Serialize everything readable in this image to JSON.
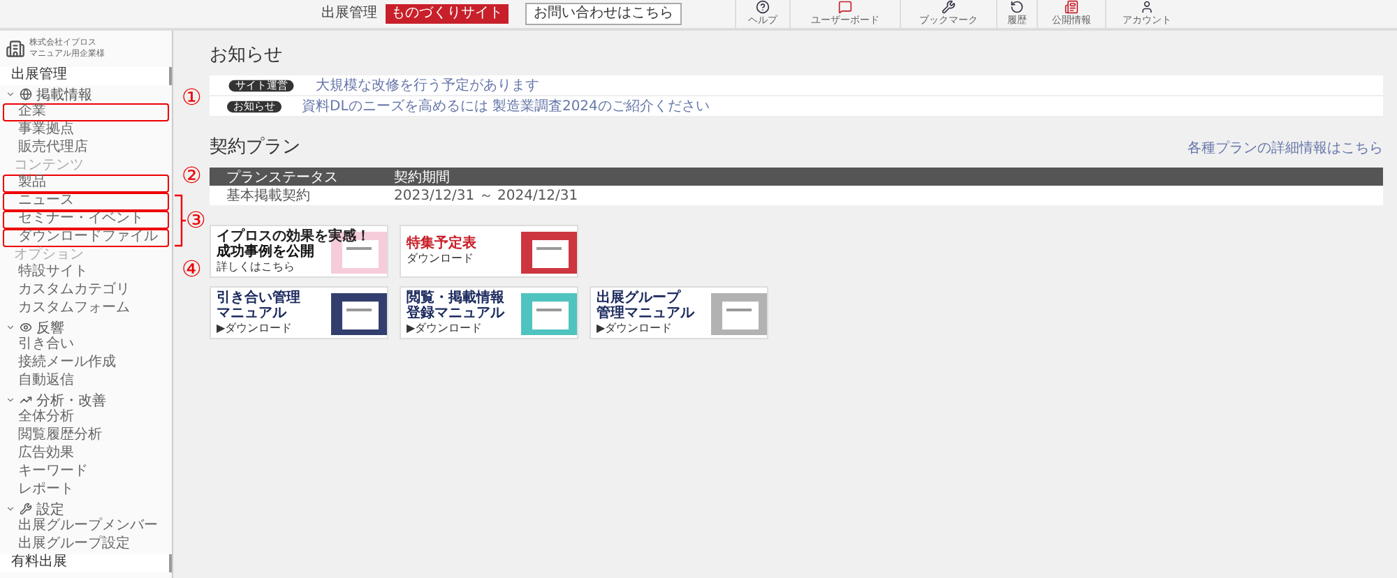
{
  "top_bar": {
    "title": "出展管理",
    "badge": "ものづくりサイト",
    "contact_button": "お問い合わせはこちら",
    "tools": [
      {
        "label": "ヘルプ"
      },
      {
        "label": "ユーザーボード"
      },
      {
        "label": "ブックマーク"
      },
      {
        "label": "履歴"
      },
      {
        "label": "公開情報"
      },
      {
        "label": "アカウント"
      }
    ]
  },
  "sidebar": {
    "company": [
      "株式会社イプロス",
      "マニュアル用企業様"
    ],
    "entries": [
      {
        "kind": "title",
        "label": "出展管理"
      },
      {
        "kind": "group",
        "label": "掲載情報",
        "expanded": true,
        "children": [
          {
            "label": "企業",
            "highlighted": true
          },
          {
            "label": "事業拠点",
            "highlighted": false
          },
          {
            "label": "販売代理店",
            "highlighted": false
          }
        ]
      },
      {
        "kind": "heading",
        "label": "コンテンツ",
        "children": [
          {
            "label": "製品",
            "highlighted": true
          },
          {
            "label": "ニュース",
            "highlighted": true
          },
          {
            "label": "セミナー・イベント",
            "highlighted": true
          },
          {
            "label": "ダウンロードファイル",
            "highlighted": true
          }
        ]
      },
      {
        "kind": "heading",
        "label": "オプション",
        "children": [
          {
            "label": "特設サイト",
            "highlighted": false
          },
          {
            "label": "カスタムカテゴリ",
            "highlighted": false
          },
          {
            "label": "カスタムフォーム",
            "highlighted": false
          }
        ]
      },
      {
        "kind": "group",
        "label": "反響",
        "expanded": true,
        "children": [
          {
            "label": "引き合い",
            "highlighted": false
          },
          {
            "label": "接続メール作成",
            "highlighted": false
          },
          {
            "label": "自動返信",
            "highlighted": false
          }
        ]
      },
      {
        "kind": "group",
        "label": "分析・改善",
        "expanded": true,
        "children": [
          {
            "label": "全体分析",
            "highlighted": false
          },
          {
            "label": "閲覧履歴分析",
            "highlighted": false
          },
          {
            "label": "広告効果",
            "highlighted": false
          },
          {
            "label": "キーワード",
            "highlighted": false
          },
          {
            "label": "レポート",
            "highlighted": false
          }
        ]
      },
      {
        "kind": "group",
        "label": "設定",
        "expanded": true,
        "children": [
          {
            "label": "出展グループメンバー",
            "highlighted": false
          },
          {
            "label": "出展グループ設定",
            "highlighted": false
          }
        ]
      },
      {
        "kind": "title",
        "label": "有料出展"
      }
    ]
  },
  "notices": {
    "title": "お知らせ",
    "items": [
      {
        "tag": "サイト運営",
        "text": "大規模な改修を行う予定があります"
      },
      {
        "tag": "お知らせ",
        "text": "資料DLのニーズを高めるには 製造業調査2024のご紹介ください"
      }
    ]
  },
  "plan": {
    "title": "契約プラン",
    "link": "各種プランの詳細情報はこちら",
    "columns": [
      "プランステータス",
      "契約期間"
    ],
    "rows": [
      [
        "基本掲載契約",
        "2023/12/31 ～ 2024/12/31"
      ]
    ]
  },
  "banners": [
    [
      {
        "lines": [
          "イプロスの効果を実感！",
          "成功事例を公開"
        ],
        "action": "詳しくはこちら"
      },
      {
        "lines": [
          "特集予定表"
        ],
        "action": "ダウンロード"
      }
    ],
    [
      {
        "lines": [
          "引き合い管理",
          "マニュアル"
        ],
        "action": "▶ダウンロード"
      },
      {
        "lines": [
          "閲覧・掲載情報",
          "登録マニュアル"
        ],
        "action": "▶ダウンロード"
      },
      {
        "lines": [
          "出展グループ",
          "管理マニュアル"
        ],
        "action": "▶ダウンロード"
      }
    ]
  ],
  "annotations": [
    {
      "label": "①"
    },
    {
      "label": "②"
    },
    {
      "label": "③"
    },
    {
      "label": "④"
    }
  ]
}
